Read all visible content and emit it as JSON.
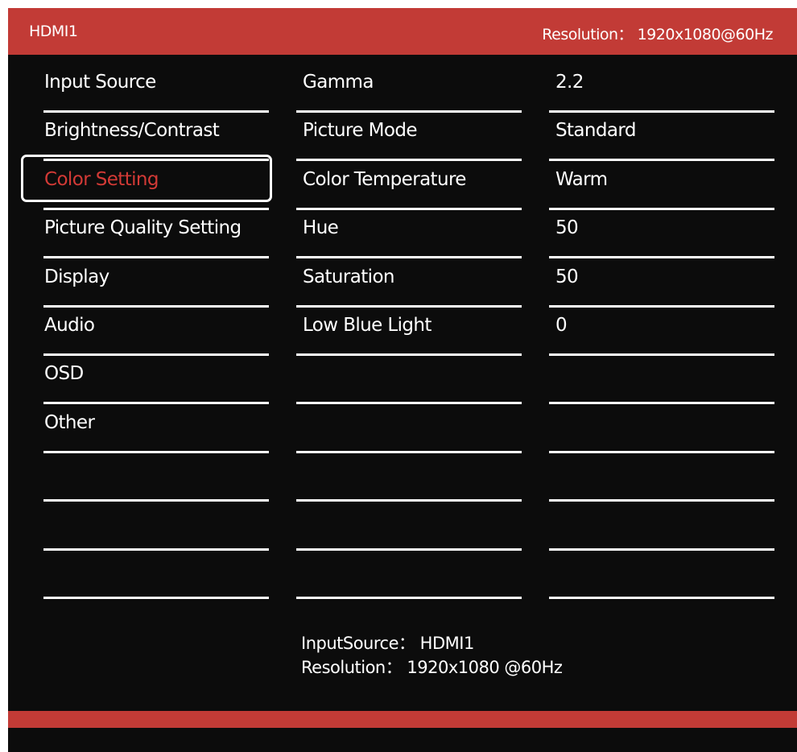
{
  "header": {
    "source": "HDMI1",
    "resolution": "Resolution： 1920x1080@60Hz"
  },
  "menu": {
    "items": [
      "Input Source",
      "Brightness/Contrast",
      "Color Setting",
      "Picture Quality Setting",
      "Display",
      "Audio",
      "OSD",
      "Other",
      "",
      "",
      ""
    ],
    "selected": "Color Setting"
  },
  "settings": {
    "labels": [
      "Gamma",
      "Picture Mode",
      "Color Temperature",
      "Hue",
      "Saturation",
      "Low Blue Light",
      "",
      "",
      "",
      "",
      ""
    ],
    "values": [
      "2.2",
      "Standard",
      "Warm",
      "50",
      "50",
      "0",
      "",
      "",
      "",
      "",
      ""
    ]
  },
  "info": {
    "input_source": "InputSource： HDMI1",
    "resolution": "Resolution： 1920x1080 @60Hz"
  },
  "colors": {
    "accent": "#c23b36",
    "selected_text": "#d33a36",
    "background": "#0c0c0c",
    "text": "#ffffff"
  }
}
